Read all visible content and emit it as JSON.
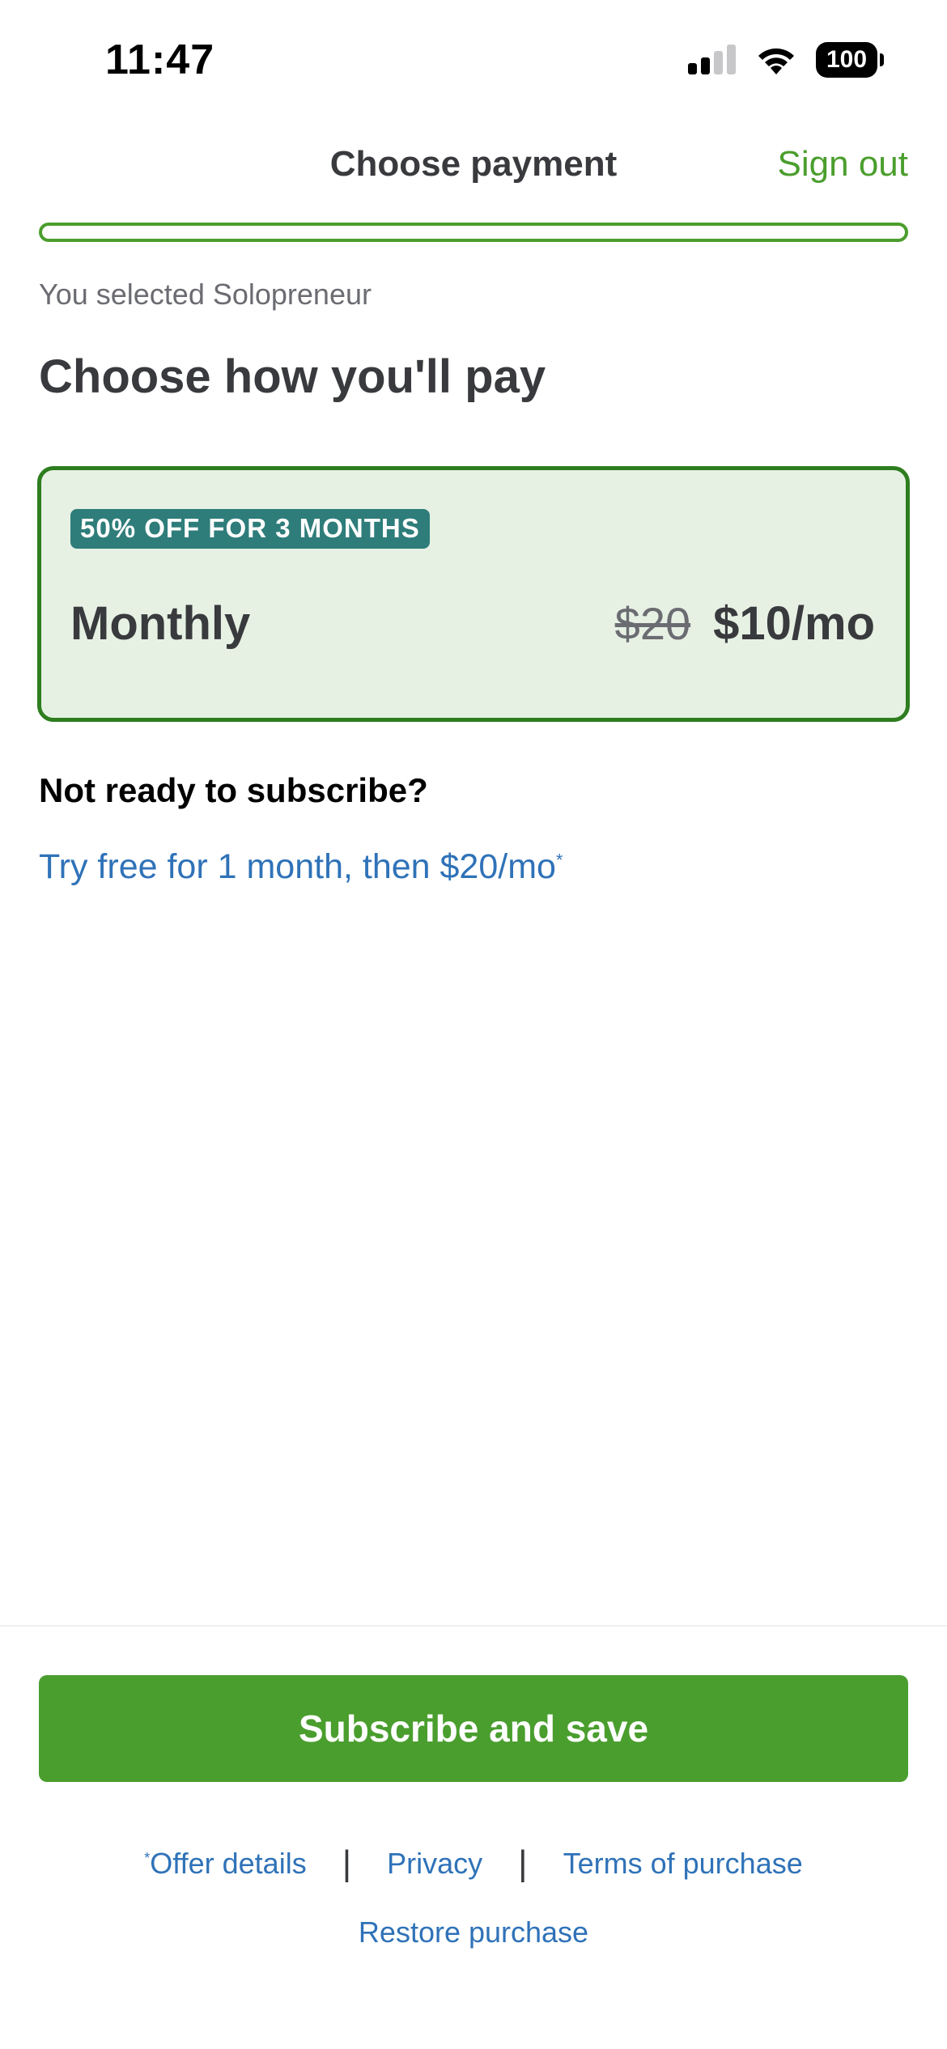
{
  "status_bar": {
    "time": "11:47",
    "battery": "100",
    "icons": [
      "signal-icon",
      "wifi-icon",
      "battery-icon"
    ]
  },
  "header": {
    "title": "Choose payment",
    "sign_out": "Sign out"
  },
  "progress": {
    "fraction": 0.0
  },
  "selected_note": "You selected Solopreneur",
  "heading": "Choose how you'll pay",
  "plan": {
    "badge": "50% OFF FOR 3 MONTHS",
    "name": "Monthly",
    "original_price": "$20",
    "discounted_price": "$10/mo"
  },
  "trial": {
    "question": "Not ready to subscribe?",
    "link_text": "Try free for 1 month, then $20/mo",
    "footnote_mark": "*"
  },
  "cta": {
    "label": "Subscribe and save"
  },
  "footer": {
    "offer_mark": "*",
    "offer_details": "Offer details",
    "separator": "|",
    "privacy": "Privacy",
    "terms": "Terms of purchase",
    "restore": "Restore purchase"
  },
  "colors": {
    "brand_green": "#4b9e2d",
    "card_border": "#2e7d1f",
    "card_bg": "#e6f1e4",
    "badge_bg": "#2e7d7a",
    "link_blue": "#2f72b8",
    "text_dark": "#393a3d"
  }
}
